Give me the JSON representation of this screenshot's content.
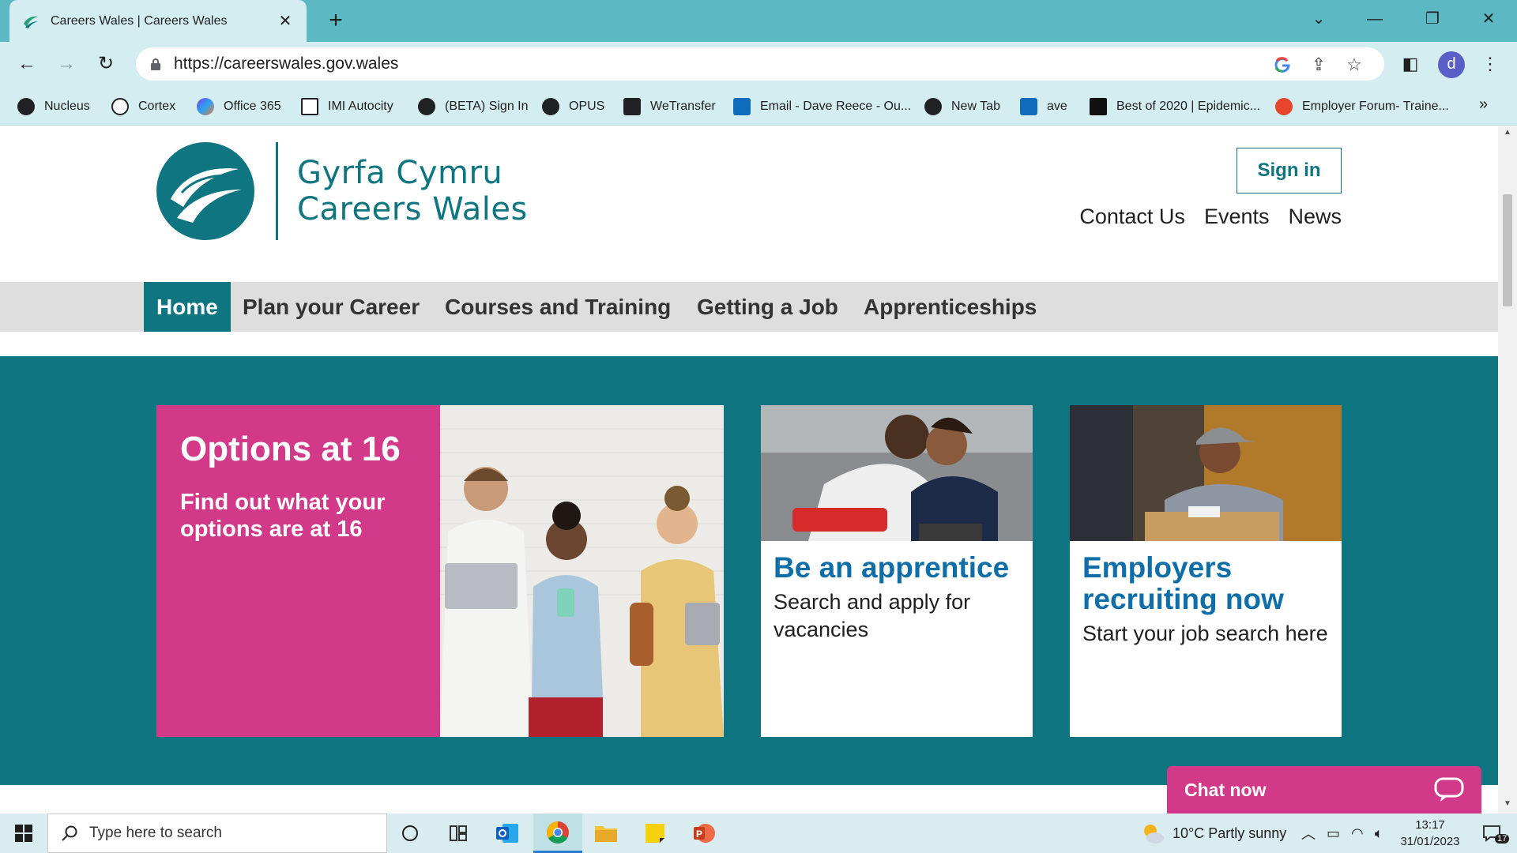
{
  "browser": {
    "tab_title": "Careers Wales | Careers Wales",
    "url": "https://careerswales.gov.wales",
    "profile_initial": "d",
    "bookmarks": [
      {
        "label": "Nucleus",
        "icon": "globe-icon"
      },
      {
        "label": "Cortex",
        "icon": "cortex-icon"
      },
      {
        "label": "Office 365",
        "icon": "office-icon"
      },
      {
        "label": "IMI Autocity",
        "icon": "imi-icon"
      },
      {
        "label": "(BETA) Sign In",
        "icon": "globe-icon"
      },
      {
        "label": "OPUS",
        "icon": "globe-icon"
      },
      {
        "label": "WeTransfer",
        "icon": "wetransfer-icon"
      },
      {
        "label": "Email - Dave Reece - Ou...",
        "icon": "outlook-icon"
      },
      {
        "label": "New Tab",
        "icon": "globe-icon"
      },
      {
        "label": "ave",
        "icon": "outlook-icon"
      },
      {
        "label": "Best of 2020 | Epidemic...",
        "icon": "epidemic-icon"
      },
      {
        "label": "Employer Forum- Traine...",
        "icon": "employer-icon"
      }
    ]
  },
  "site": {
    "logo_line1": "Gyrfa Cymru",
    "logo_line2": "Careers Wales",
    "signin_label": "Sign in",
    "top_links": [
      "Contact Us",
      "Events",
      "News"
    ],
    "nav": [
      "Home",
      "Plan your Career",
      "Courses and Training",
      "Getting a Job",
      "Apprenticeships"
    ],
    "hero_card": {
      "title": "Options at 16",
      "subtitle": "Find out what your options are at 16"
    },
    "cards": [
      {
        "title": "Be an apprentice",
        "text": "Search and apply for vacancies"
      },
      {
        "title": "Employers recruiting now",
        "text": "Start your job search here"
      }
    ],
    "chat_label": "Chat now"
  },
  "taskbar": {
    "search_placeholder": "Type here to search",
    "weather": "10°C  Partly sunny",
    "time": "13:17",
    "date": "31/01/2023",
    "notification_count": "17"
  },
  "colors": {
    "brand_teal": "#0f7581",
    "brand_pink": "#d23a89",
    "card_title_blue": "#0f6ea7",
    "chrome_teal": "#5cb8c3"
  }
}
